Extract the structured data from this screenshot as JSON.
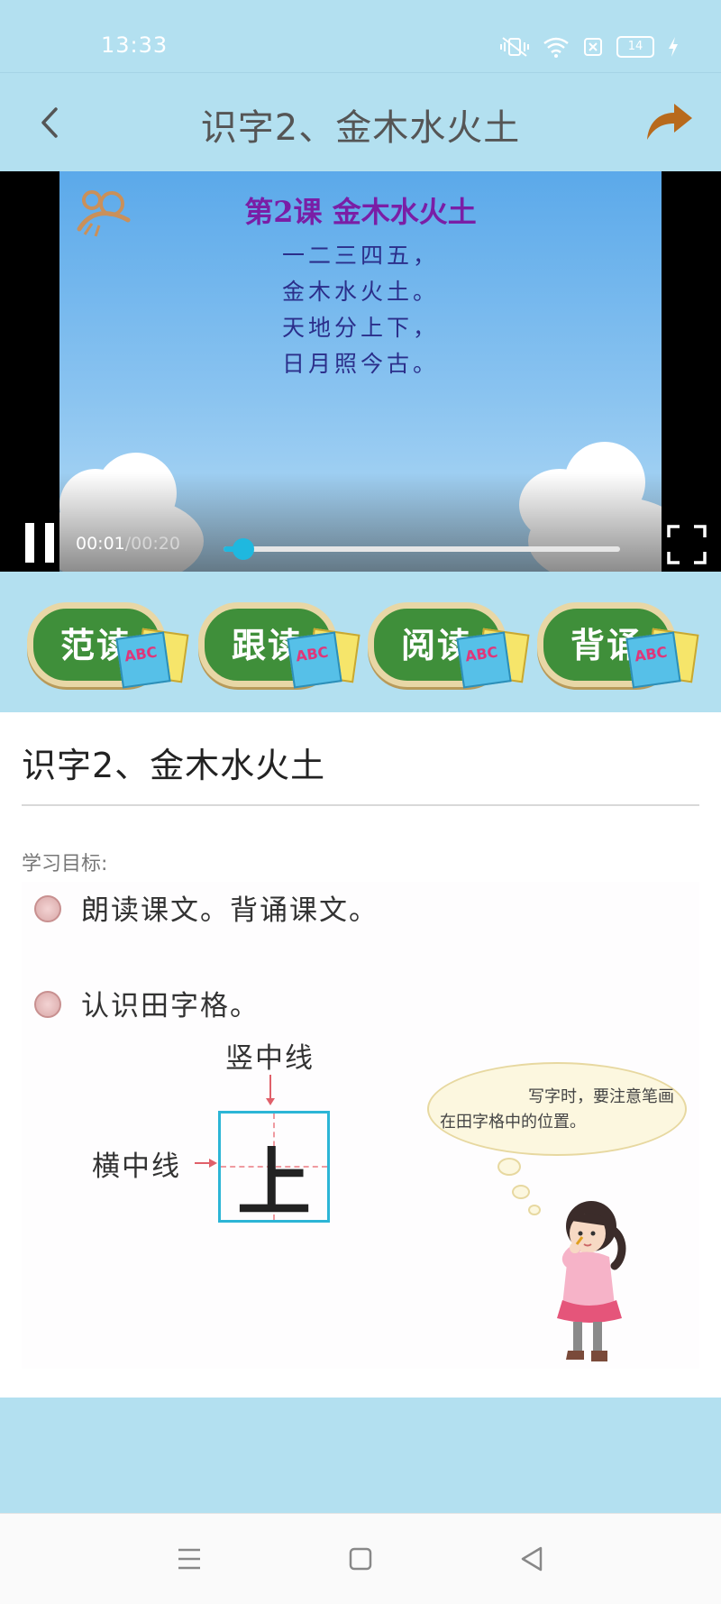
{
  "status_bar": {
    "time": "13:33",
    "battery_level": "14",
    "icons": [
      "mute-vibrate-icon",
      "wifi-icon",
      "sim-off-icon",
      "battery-icon",
      "charging-icon"
    ]
  },
  "app_bar": {
    "title": "识字2、金木水火土",
    "back_icon": "chevron-left-icon",
    "share_icon": "share-arrow-icon"
  },
  "video": {
    "slide_title": "第2课  金木水火土",
    "poem_lines": [
      "一二三四五，",
      "金木水火土。",
      "天地分上下，",
      "日月照今古。"
    ],
    "current_time": "00:01",
    "total_time": "/00:20",
    "progress_fraction": 0.05,
    "accent_color": "#1fb8df"
  },
  "modes": [
    {
      "label": "范读"
    },
    {
      "label": "跟读"
    },
    {
      "label": "阅读"
    },
    {
      "label": "背诵"
    }
  ],
  "content": {
    "heading": "识字2、金木水火土",
    "goals_label": "学习目标:",
    "goals": [
      "朗读课文。背诵课文。",
      "认识田字格。"
    ],
    "grid_char": "上",
    "vertical_line_label": "竖中线",
    "horizontal_line_label": "横中线",
    "speech_line1": "写字时，要注意笔画",
    "speech_line2": "在田字格中的位置。"
  },
  "nav_bar": {
    "icons": [
      "menu-icon",
      "home-square-icon",
      "back-triangle-icon"
    ]
  }
}
